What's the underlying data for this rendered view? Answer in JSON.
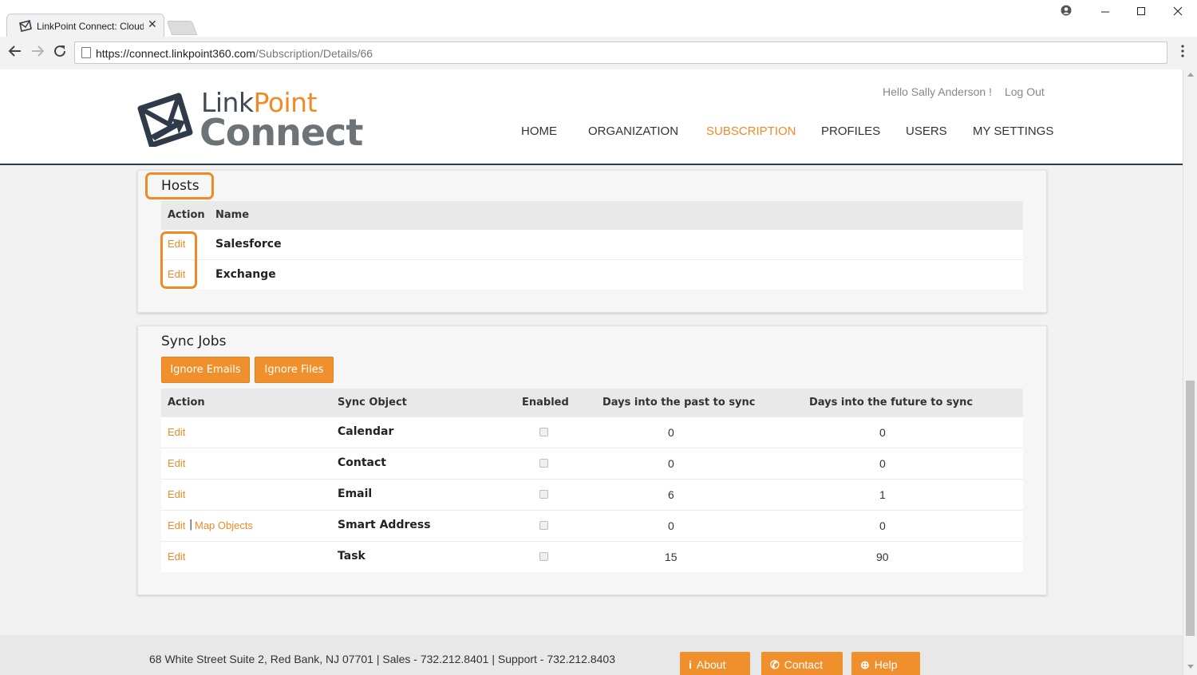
{
  "browser": {
    "tab_title": "LinkPoint Connect: Cloud",
    "tab_close": "✕",
    "url_host": "https://connect.linkpoint360.com",
    "url_path": "/Subscription/Details/66"
  },
  "header": {
    "logo_line1": "LinkPoint",
    "logo_line2": "Connect",
    "greeting": "Hello Sally Anderson !",
    "logout": "Log Out",
    "nav": [
      "HOME",
      "ORGANIZATION",
      "SUBSCRIPTION",
      "PROFILES",
      "USERS",
      "MY SETTINGS"
    ],
    "active_nav": "SUBSCRIPTION"
  },
  "hosts": {
    "title": "Hosts",
    "columns": [
      "Action",
      "Name"
    ],
    "rows": [
      {
        "action": "Edit",
        "name": "Salesforce"
      },
      {
        "action": "Edit",
        "name": "Exchange"
      }
    ]
  },
  "sync_jobs": {
    "title": "Sync Jobs",
    "buttons": [
      "Ignore Emails",
      "Ignore Files"
    ],
    "columns": [
      "Action",
      "Sync Object",
      "Enabled",
      "Days into the past to sync",
      "Days into the future to sync"
    ],
    "rows": [
      {
        "action": "Edit",
        "extra": "",
        "object": "Calendar",
        "enabled": false,
        "past": "0",
        "future": "0"
      },
      {
        "action": "Edit",
        "extra": "",
        "object": "Contact",
        "enabled": false,
        "past": "0",
        "future": "0"
      },
      {
        "action": "Edit",
        "extra": "",
        "object": "Email",
        "enabled": false,
        "past": "6",
        "future": "1"
      },
      {
        "action": "Edit",
        "extra": "Map Objects",
        "object": "Smart Address",
        "enabled": false,
        "past": "0",
        "future": "0"
      },
      {
        "action": "Edit",
        "extra": "",
        "object": "Task",
        "enabled": false,
        "past": "15",
        "future": "90"
      }
    ]
  },
  "footer": {
    "address": "68 White Street Suite 2, Red Bank, NJ 07701 | Sales - 732.212.8401 | Support - 732.212.8403",
    "buttons": [
      "About",
      "Contact",
      "Help"
    ]
  },
  "colors": {
    "accent": "#f08a24",
    "header_border": "#2f3b48"
  }
}
